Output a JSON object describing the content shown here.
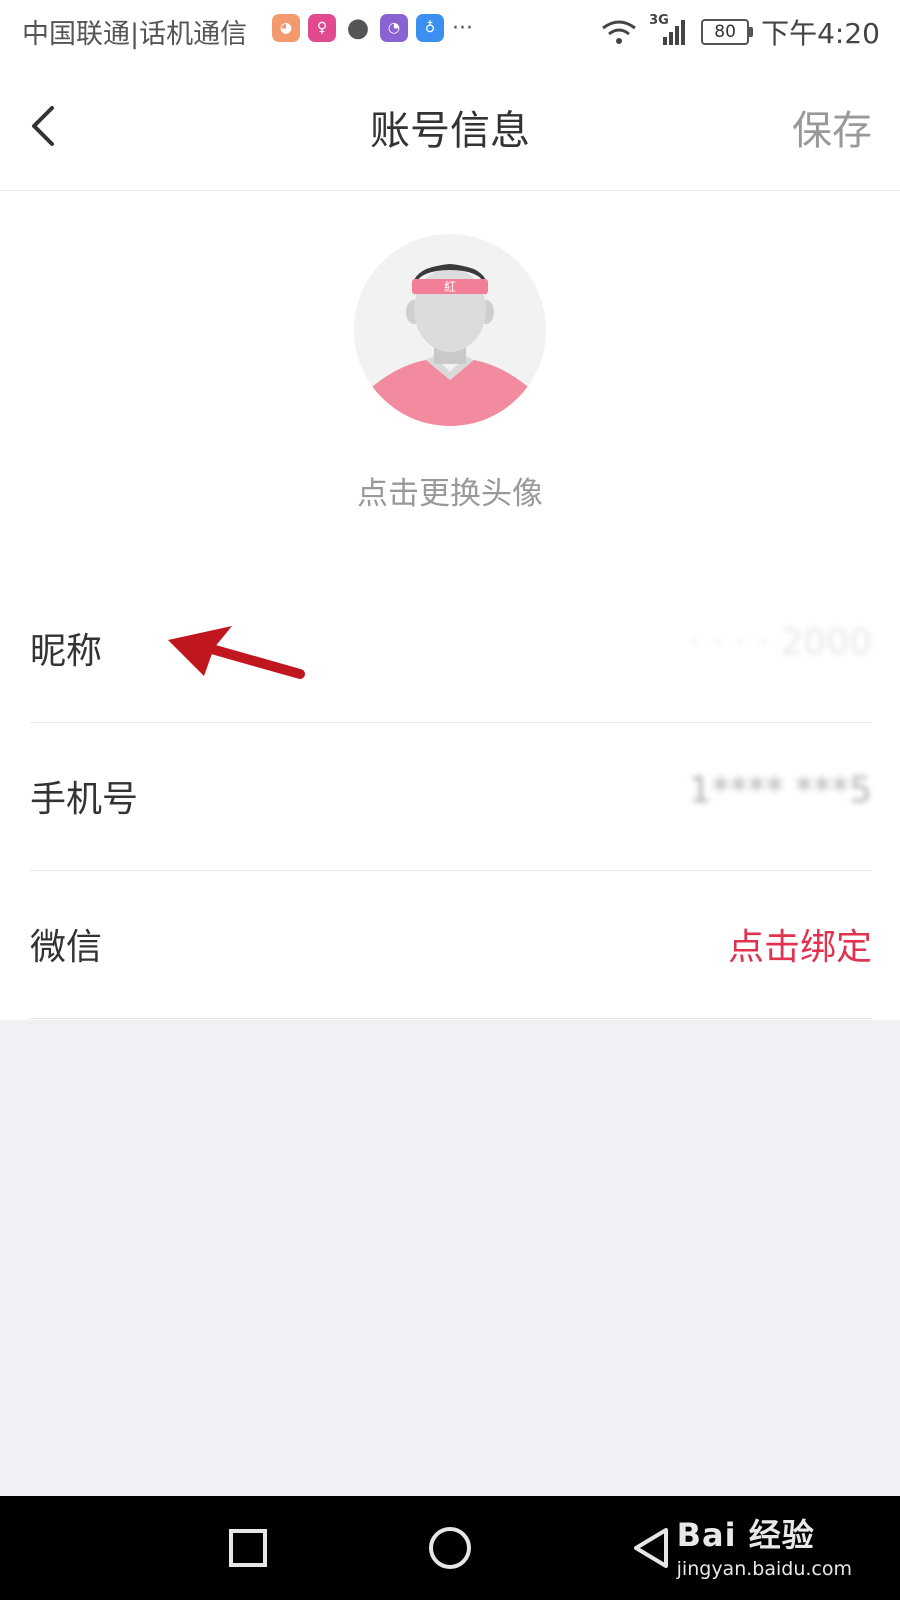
{
  "status_bar": {
    "carrier": "中国联通|话机通信",
    "more": "···",
    "battery": "80",
    "time": "下午4:20",
    "network": "3G"
  },
  "header": {
    "title": "账号信息",
    "save_label": "保存"
  },
  "avatar": {
    "headband_text": "紅",
    "change_label": "点击更换头像"
  },
  "rows": [
    {
      "label": "昵称",
      "value": "· · · · 2000"
    },
    {
      "label": "手机号",
      "value": "1**** ***5"
    },
    {
      "label": "微信",
      "value": "点击绑定"
    }
  ],
  "watermark": {
    "main": "Bai 经验",
    "sub": "jingyan.baidu.com"
  },
  "colors": {
    "accent": "#e0334f",
    "gray_bg": "#eff1f4",
    "annotation_arrow": "#c0171e"
  }
}
